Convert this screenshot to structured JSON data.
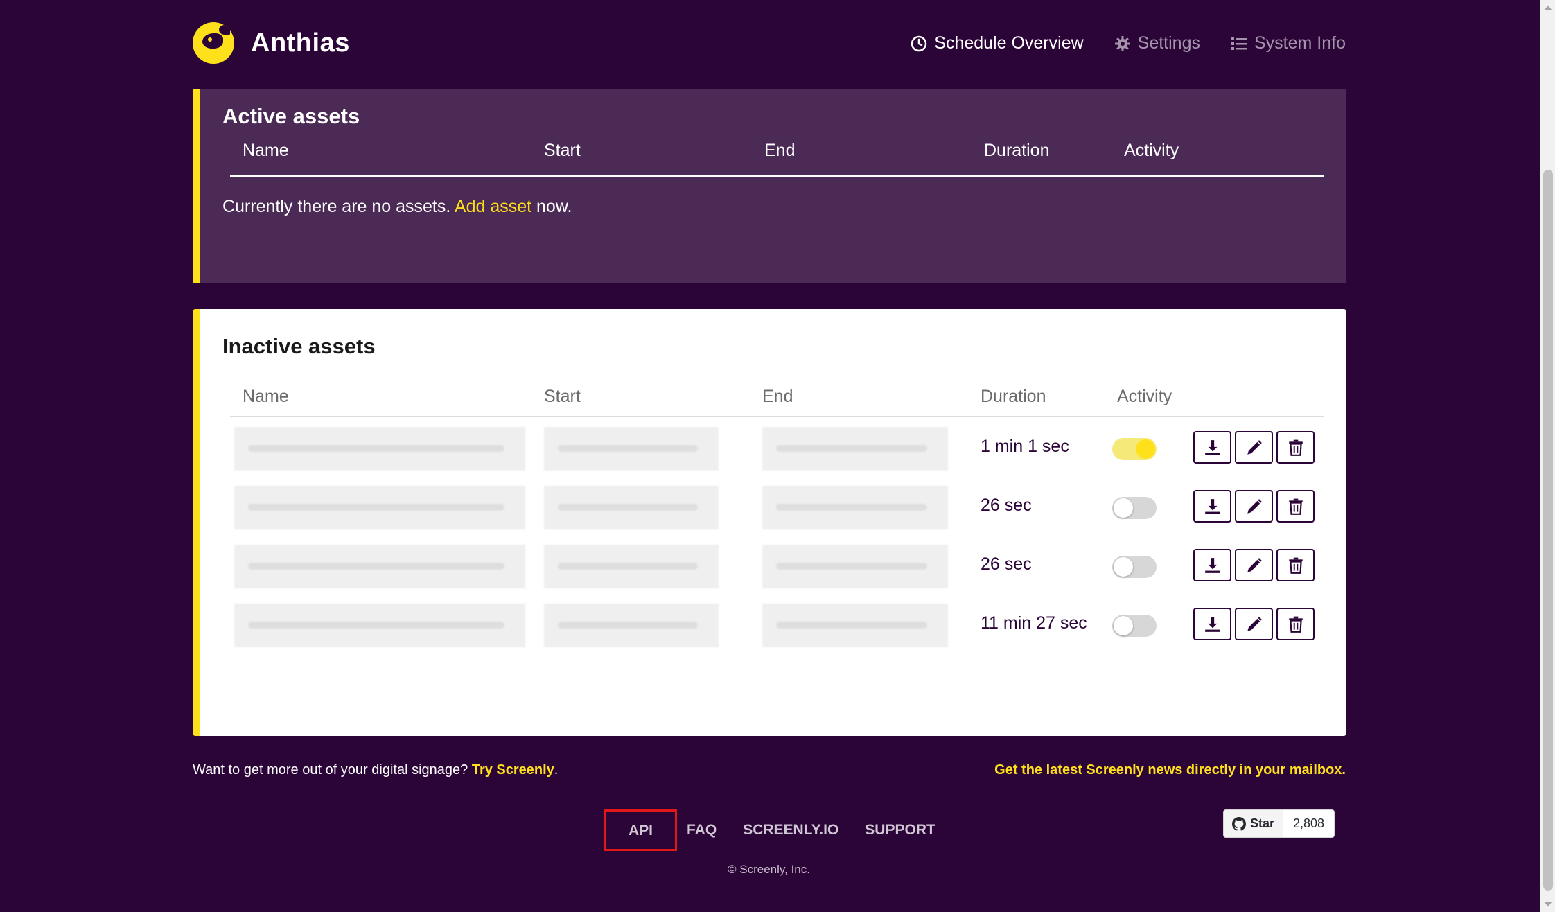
{
  "app": {
    "name": "Anthias"
  },
  "nav": {
    "items": [
      {
        "label": "Schedule Overview",
        "icon": "clock-icon",
        "active": true
      },
      {
        "label": "Settings",
        "icon": "gear-icon",
        "active": false
      },
      {
        "label": "System Info",
        "icon": "list-icon",
        "active": false
      }
    ]
  },
  "active_assets": {
    "title": "Active assets",
    "columns": [
      "Name",
      "Start",
      "End",
      "Duration",
      "Activity"
    ],
    "empty_prefix": "Currently there are no assets. ",
    "empty_link": "Add asset",
    "empty_suffix": " now."
  },
  "inactive_assets": {
    "title": "Inactive assets",
    "columns": [
      "Name",
      "Start",
      "End",
      "Duration",
      "Activity"
    ],
    "rows": [
      {
        "duration": "1 min 1 sec",
        "activity": true
      },
      {
        "duration": "26 sec",
        "activity": false
      },
      {
        "duration": "26 sec",
        "activity": false
      },
      {
        "duration": "11 min 27 sec",
        "activity": false
      }
    ]
  },
  "footer": {
    "promo_text": "Want to get more out of your digital signage? ",
    "promo_link": "Try Screenly",
    "promo_end": ".",
    "news_link": "Get the latest Screenly news directly in your mailbox.",
    "links": [
      "API",
      "FAQ",
      "SCREENLY.IO",
      "SUPPORT"
    ],
    "copyright": "© Screenly, Inc.",
    "github": {
      "label": "Star",
      "count": "2,808"
    }
  },
  "colors": {
    "background": "#2c0538",
    "accent": "#ffe11b",
    "active_panel": "#4b2a56",
    "highlight_box": "#e01818"
  }
}
